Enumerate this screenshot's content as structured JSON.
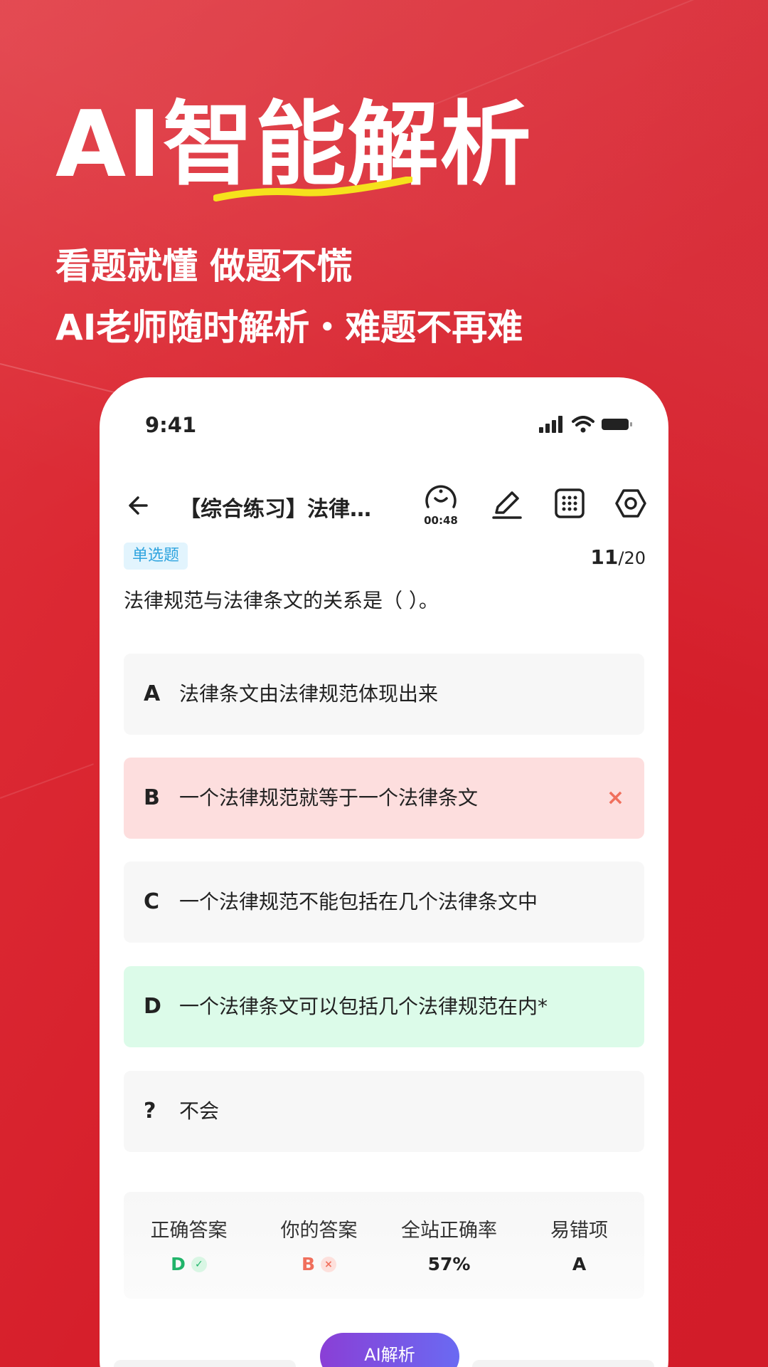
{
  "hero": {
    "title": "AI智能解析",
    "subtitle1": "看题就懂 做题不慌",
    "subtitle2": "AI老师随时解析・难题不再难"
  },
  "status_bar": {
    "time": "9:41",
    "icons": [
      "signal-icon",
      "wifi-icon",
      "battery-icon"
    ]
  },
  "nav": {
    "title": "【综合练习】法律…",
    "timer": "00:48",
    "icons": [
      "back-arrow-icon",
      "timer-icon",
      "edit-icon",
      "grid-icon",
      "settings-icon"
    ]
  },
  "question": {
    "type": "单选题",
    "current": "11",
    "total": "/20",
    "text": "法律规范与法律条文的关系是（ ）。"
  },
  "options": [
    {
      "letter": "A",
      "text": "法律条文由法律规范体现出来",
      "state": "normal"
    },
    {
      "letter": "B",
      "text": "一个法律规范就等于一个法律条文",
      "state": "wrong",
      "mark": "×"
    },
    {
      "letter": "C",
      "text": "一个法律规范不能包括在几个法律条文中",
      "state": "normal"
    },
    {
      "letter": "D",
      "text": "一个法律条文可以包括几个法律规范在内*",
      "state": "right"
    },
    {
      "letter": "?",
      "text": "不会",
      "state": "normal"
    }
  ],
  "stats": {
    "correct_label": "正确答案",
    "correct_value": "D",
    "yours_label": "你的答案",
    "yours_value": "B",
    "rate_label": "全站正确率",
    "rate_value": "57%",
    "error_label": "易错项",
    "error_value": "A"
  },
  "ai_button": {
    "label": "AI解析"
  },
  "colors": {
    "background": "#d9232e",
    "wrong_bg": "#fddede",
    "right_bg": "#dcfbe9",
    "tag_bg": "#e2f4fd",
    "tag_text": "#2fa4df",
    "ai_gradient_start": "#8a3fd6",
    "ai_gradient_end": "#6a6af2"
  }
}
